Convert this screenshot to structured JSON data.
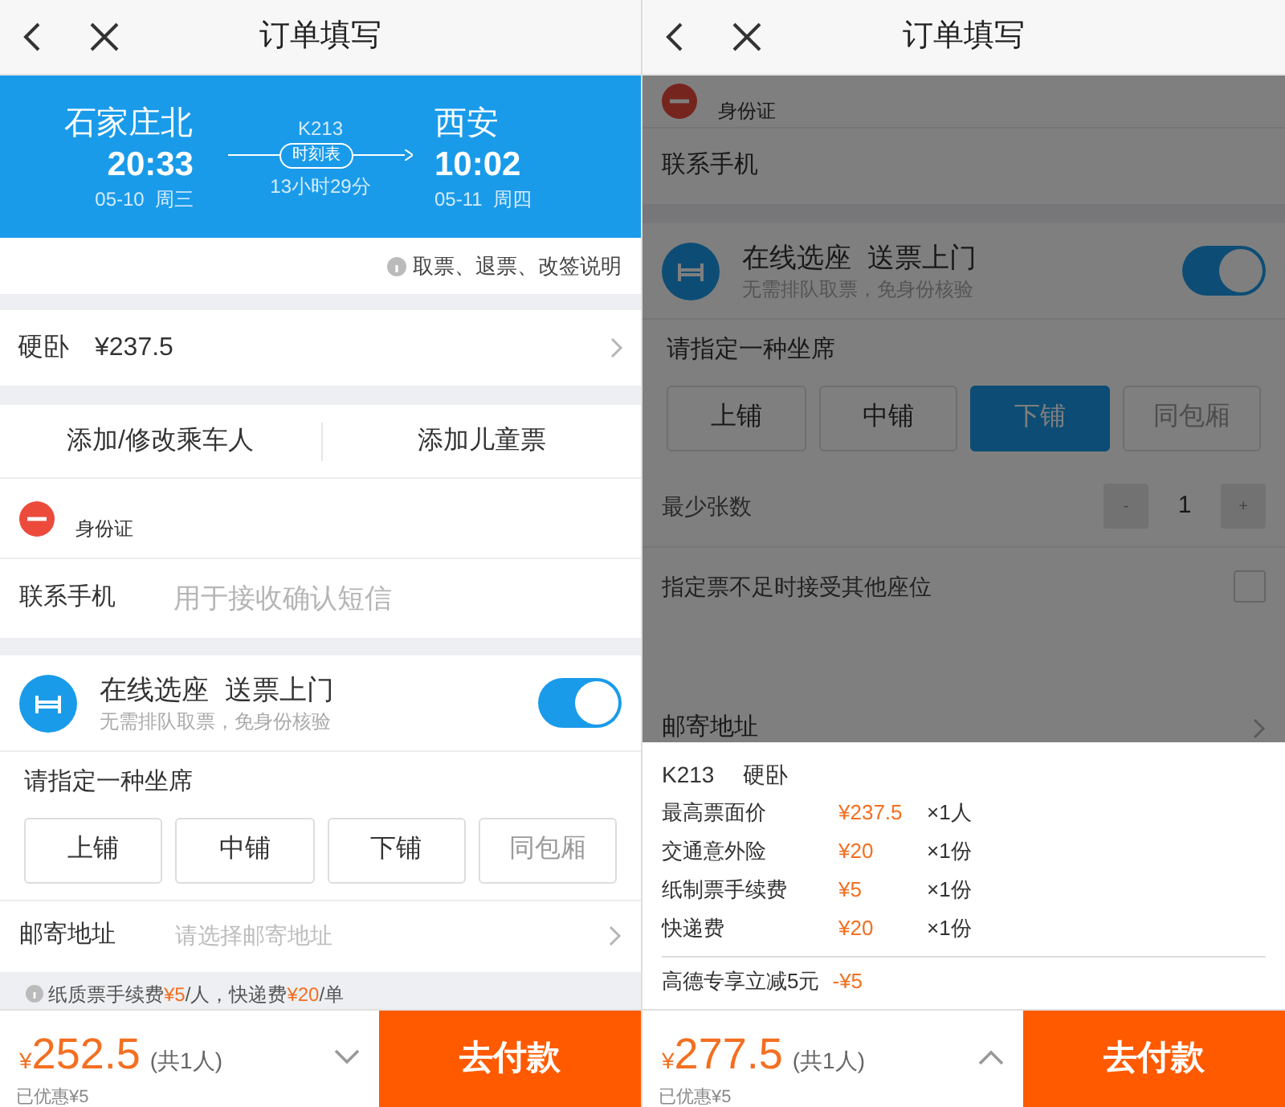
{
  "order_form": {
    "nav": {
      "title": "订单填写"
    },
    "trip": {
      "from_station": "石家庄北",
      "depart_time": "20:33",
      "depart_date": "05-10  周三",
      "train": "K213",
      "timetable_button": "时刻表",
      "duration": "13小时29分",
      "to_station": "西安",
      "arrive_time": "10:02",
      "arrive_date": "05-11  周四"
    },
    "notice": "取票、退票、改签说明",
    "seat_class": {
      "name": "硬卧",
      "price": "¥237.5"
    },
    "passenger_actions": [
      "添加/修改乘车人",
      "添加儿童票"
    ],
    "passenger": {
      "id_type": "身份证"
    },
    "contact": {
      "label": "联系手机",
      "placeholder": "用于接收确认短信"
    },
    "online_seat": {
      "title": "在线选座",
      "title_extra": "送票上门",
      "note": "无需排队取票，免身份核验",
      "on": true
    },
    "seat_prompt": "请指定一种坐席",
    "seat_options": [
      {
        "label": "上铺",
        "selected": false,
        "disabled": false
      },
      {
        "label": "中铺",
        "selected": false,
        "disabled": false
      },
      {
        "label": "下铺",
        "selected": false,
        "disabled": false
      },
      {
        "label": "同包厢",
        "selected": false,
        "disabled": true
      }
    ],
    "address": {
      "label": "邮寄地址",
      "placeholder": "请选择邮寄地址"
    },
    "fee_note": [
      {
        "text": "纸质票手续费",
        "highlight": false
      },
      {
        "text": "¥5",
        "highlight": true
      },
      {
        "text": "/人，快递费",
        "highlight": false
      },
      {
        "text": "¥20",
        "highlight": true
      },
      {
        "text": "/单",
        "highlight": false
      }
    ],
    "footer": {
      "currency": "¥",
      "total": "252.5",
      "count": "(共1人)",
      "discount": "已优惠¥5",
      "expanded": false,
      "pay": "去付款"
    }
  },
  "fare_detail_view": {
    "nav": {
      "title": "订单填写"
    },
    "passenger": {
      "id_type": "身份证"
    },
    "contact": {
      "label": "联系手机"
    },
    "online_seat": {
      "title": "在线选座",
      "title_extra": "送票上门",
      "note": "无需排队取票，免身份核验",
      "on": true
    },
    "seat_prompt": "请指定一种坐席",
    "seat_options": [
      {
        "label": "上铺",
        "selected": false,
        "disabled": false
      },
      {
        "label": "中铺",
        "selected": false,
        "disabled": false
      },
      {
        "label": "下铺",
        "selected": true,
        "disabled": false
      },
      {
        "label": "同包厢",
        "selected": false,
        "disabled": true
      }
    ],
    "min_tickets": {
      "label": "最少张数",
      "minus": "-",
      "value": "1",
      "plus": "+"
    },
    "accept_other": {
      "label": "指定票不足时接受其他座位",
      "checked": false
    },
    "address": {
      "label": "邮寄地址"
    },
    "fare_sheet": {
      "train": "K213",
      "seat_class": "硬卧",
      "lines": [
        {
          "label": "最高票面价",
          "amount": "¥237.5",
          "qty": "×1人"
        },
        {
          "label": "交通意外险",
          "amount": "¥20",
          "qty": "×1份"
        },
        {
          "label": "纸制票手续费",
          "amount": "¥5",
          "qty": "×1份"
        },
        {
          "label": "快递费",
          "amount": "¥20",
          "qty": "×1份"
        }
      ],
      "discount": {
        "label": "高德专享立减5元",
        "amount": "-¥5"
      }
    },
    "footer": {
      "currency": "¥",
      "total": "277.5",
      "count": "(共1人)",
      "discount": "已优惠¥5",
      "expanded": true,
      "pay": "去付款"
    }
  }
}
